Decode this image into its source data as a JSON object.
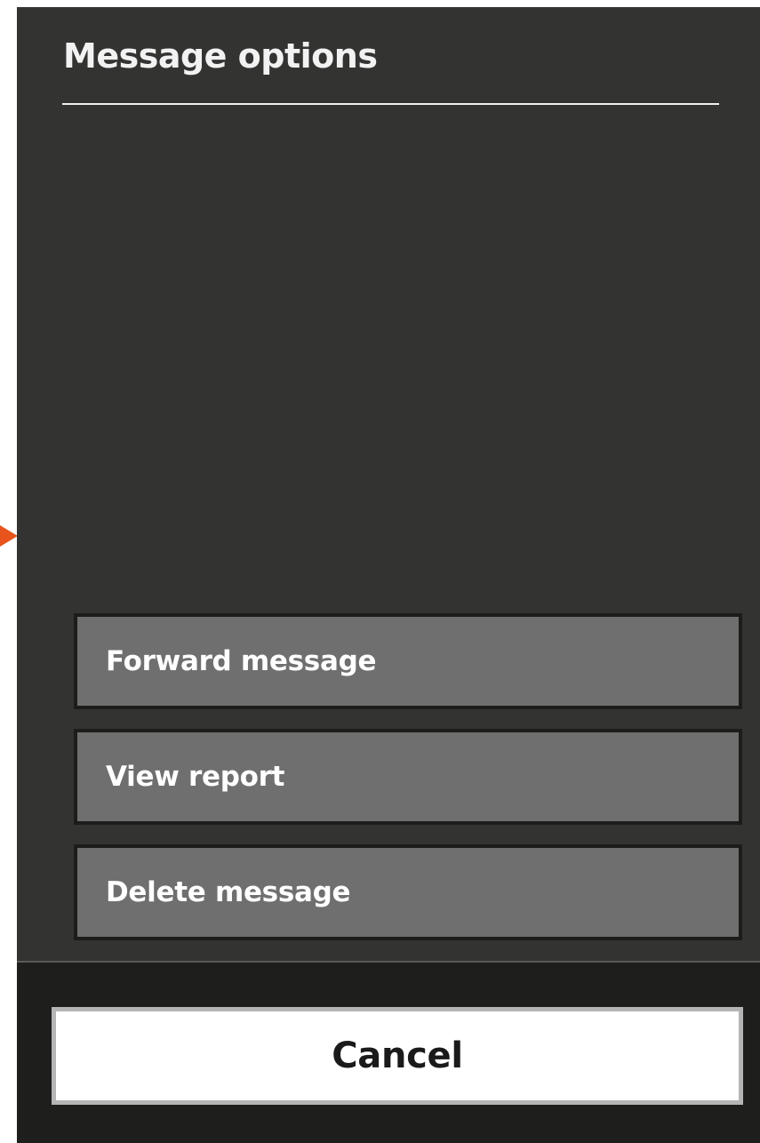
{
  "dialog": {
    "title": "Message options",
    "options": [
      {
        "label": "Forward message"
      },
      {
        "label": "View report"
      },
      {
        "label": "Delete message"
      }
    ],
    "cancel_label": "Cancel"
  },
  "colors": {
    "panel_background": "#333332",
    "option_background": "#6f6f6f",
    "footer_background": "#1e1e1d",
    "cancel_background": "#ffffff",
    "pointer_accent": "#e8541c"
  }
}
